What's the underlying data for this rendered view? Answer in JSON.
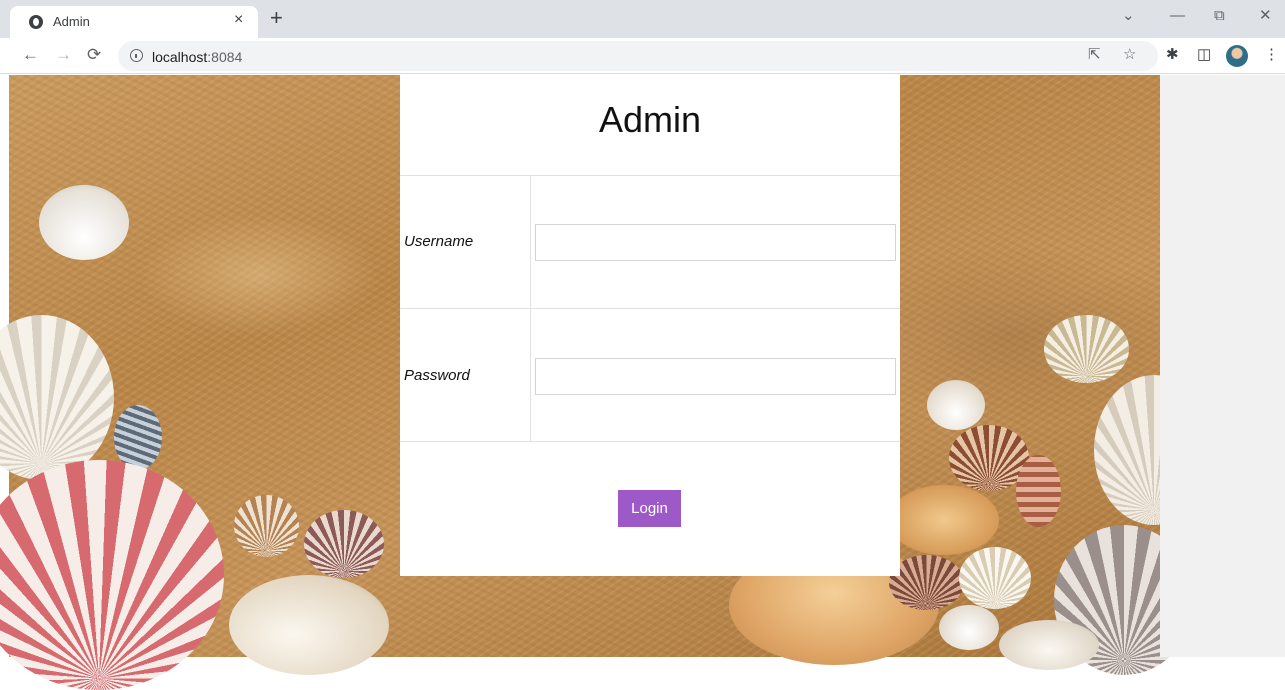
{
  "browser": {
    "tab_title": "Admin",
    "tab_close": "×",
    "new_tab": "+",
    "url_host": "localhost",
    "url_port": ":8084",
    "icons": [
      "globe-icon",
      "back-arrow-icon",
      "forward-arrow-icon",
      "reload-icon",
      "info-icon",
      "share-icon",
      "star-icon",
      "puzzle-icon",
      "side-panel-icon",
      "profile-avatar",
      "more-menu-icon",
      "tab-search-chevron-icon",
      "minimize-icon",
      "restore-icon",
      "close-window-icon"
    ]
  },
  "form": {
    "title": "Admin",
    "username_label": "Username",
    "username_value": "",
    "password_label": "Password",
    "password_value": "",
    "login_label": "Login",
    "accent_color": "#9c59c7"
  }
}
